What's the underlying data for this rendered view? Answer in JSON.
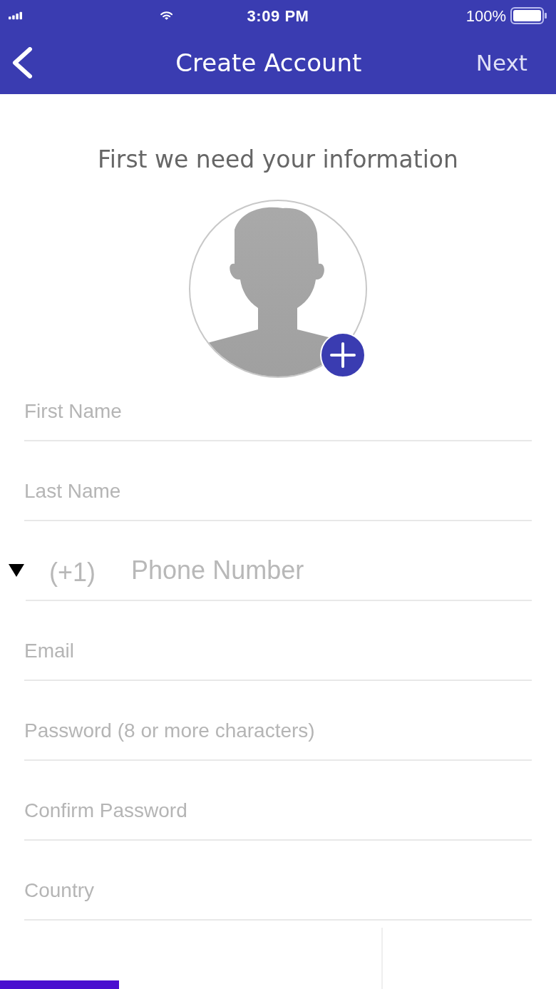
{
  "status_bar": {
    "time": "3:09 PM",
    "battery": "100%"
  },
  "nav": {
    "title": "Create Account",
    "action": "Next"
  },
  "heading": "First we need your information",
  "fields": [
    {
      "kind": "text",
      "placeholder": "First Name"
    },
    {
      "kind": "text",
      "placeholder": "Last Name"
    },
    {
      "kind": "phone",
      "country_code": "(+1)",
      "placeholder": "Phone Number"
    },
    {
      "kind": "text",
      "placeholder": "Email"
    },
    {
      "kind": "text",
      "placeholder": "Password (8 or more characters)"
    },
    {
      "kind": "text",
      "placeholder": "Confirm Password"
    },
    {
      "kind": "text",
      "placeholder": "Country"
    }
  ]
}
